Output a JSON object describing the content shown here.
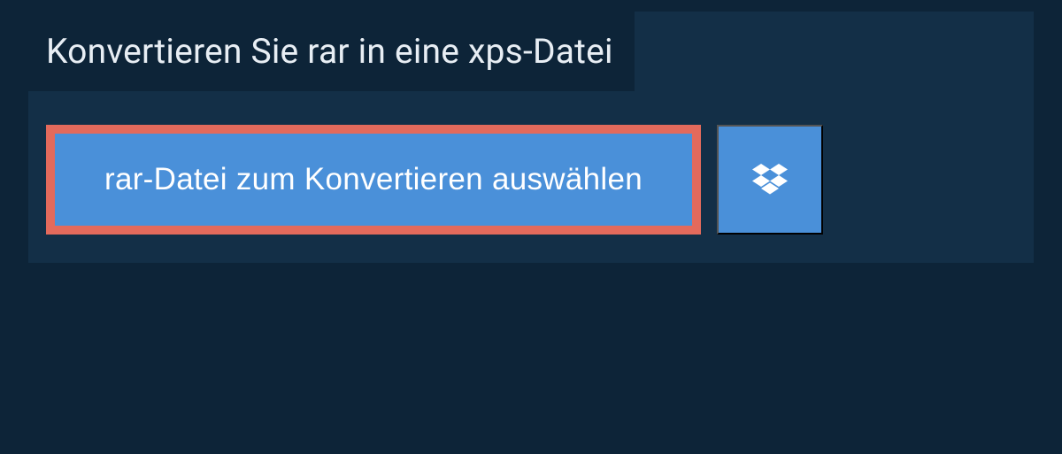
{
  "header": {
    "title": "Konvertieren Sie rar in eine xps-Datei"
  },
  "actions": {
    "select_file_label": "rar-Datei zum Konvertieren auswählen",
    "dropbox_icon": "dropbox-icon"
  },
  "colors": {
    "background_dark": "#0d2438",
    "background_panel": "#132f47",
    "button_blue": "#4a90d9",
    "highlight_border": "#e36a5c",
    "text": "#ffffff"
  }
}
